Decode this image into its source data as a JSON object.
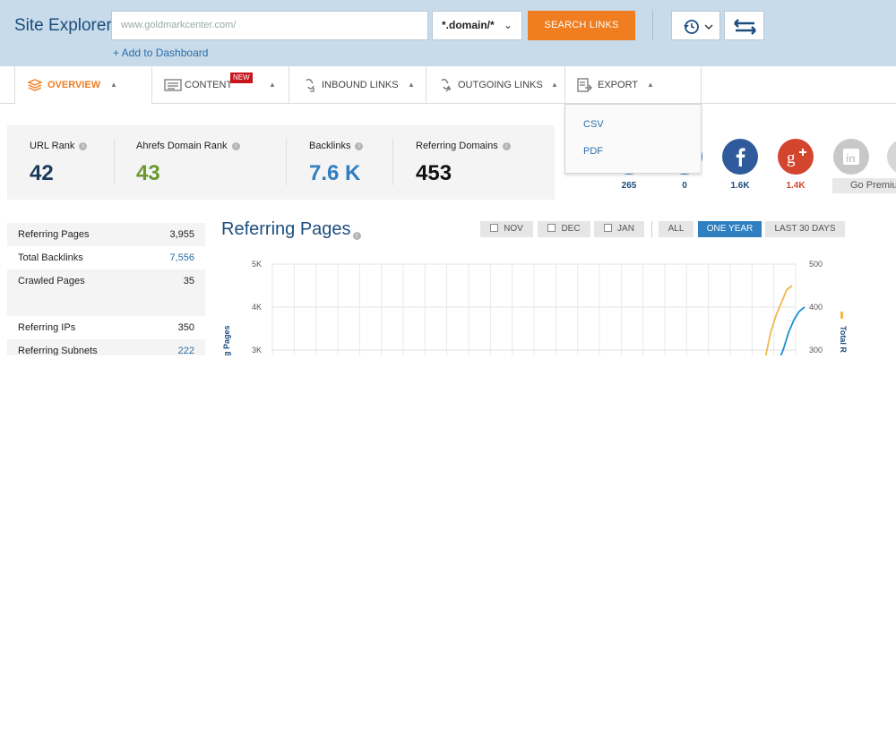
{
  "header": {
    "title": "Site Explorer:",
    "url_value": "www.goldmarkcenter.com/",
    "mode": "*.domain/*",
    "search_label": "SEARCH LINKS",
    "add_dashboard": "+ Add to Dashboard"
  },
  "nav": {
    "tabs": [
      {
        "label": "OVERVIEW",
        "icon": "layers-icon"
      },
      {
        "label": "CONTENT",
        "icon": "content-icon",
        "badge": "NEW"
      },
      {
        "label": "INBOUND LINKS",
        "icon": "inbound-links-icon"
      },
      {
        "label": "OUTGOING LINKS",
        "icon": "outgoing-links-icon"
      },
      {
        "label": "EXPORT",
        "icon": "export-icon"
      }
    ],
    "export_menu": [
      "CSV",
      "PDF"
    ]
  },
  "metrics": [
    {
      "label": "URL Rank",
      "value": "42",
      "color": "#1b3a5c"
    },
    {
      "label": "Ahrefs Domain Rank",
      "value": "43",
      "color": "#6a9a2e"
    },
    {
      "label": "Backlinks",
      "value": "7.6 K",
      "color": "#2f7fc1"
    },
    {
      "label": "Referring Domains",
      "value": "453",
      "color": "#111111"
    }
  ],
  "social": [
    {
      "name": "generic-icon",
      "count": "265",
      "color": "#2f7fc1"
    },
    {
      "name": "twitter-icon",
      "count": "0",
      "color": "#2f7fc1"
    },
    {
      "name": "facebook-icon",
      "count": "1.6K",
      "color": "#2f5a9c"
    },
    {
      "name": "google-plus-icon",
      "count": "1.4K",
      "color": "#d3452f"
    },
    {
      "name": "linkedin-icon",
      "count": "",
      "color": "#c8c8c8"
    }
  ],
  "go_premium": "Go Premiu",
  "stats": [
    {
      "label": "Referring Pages",
      "value": "3,955"
    },
    {
      "label": "Total Backlinks",
      "value": "7,556"
    },
    {
      "label": "Crawled Pages",
      "value": "35"
    },
    {
      "label": "",
      "value": ""
    },
    {
      "label": "Referring IPs",
      "value": "350"
    },
    {
      "label": "Referring Subnets",
      "value": "222"
    }
  ],
  "chart": {
    "title": "Referring Pages",
    "periods": [
      "NOV",
      "DEC",
      "JAN"
    ],
    "ranges": [
      "ALL",
      "ONE YEAR",
      "LAST 30 DAYS"
    ],
    "selected_range": "ONE YEAR",
    "left_ticks": [
      "5K",
      "4K",
      "3K"
    ],
    "right_ticks": [
      "500",
      "400",
      "300"
    ],
    "left_axis_label": "g Pages",
    "right_axis_label": "Total R"
  },
  "chart_data": {
    "type": "line",
    "title": "Referring Pages",
    "ylabel": "g Pages",
    "y2label": "Total R",
    "ylim": [
      3000,
      5000
    ],
    "y2lim": [
      300,
      500
    ],
    "series": [
      {
        "axis": "left",
        "color": "#f2b84b",
        "x": [
          0,
          1,
          2,
          3,
          4,
          5
        ],
        "values": [
          2800,
          3400,
          3800,
          4100,
          4400,
          4500
        ]
      },
      {
        "axis": "right",
        "color": "#1c8fd0",
        "x": [
          0,
          1,
          2,
          3,
          4,
          5
        ],
        "values": [
          270,
          300,
          340,
          370,
          390,
          400
        ]
      }
    ]
  },
  "colors": {
    "accent": "#f07d1f",
    "brand": "#1d4d7e",
    "link": "#2a6fa8",
    "header_bg": "#c8dbea"
  }
}
